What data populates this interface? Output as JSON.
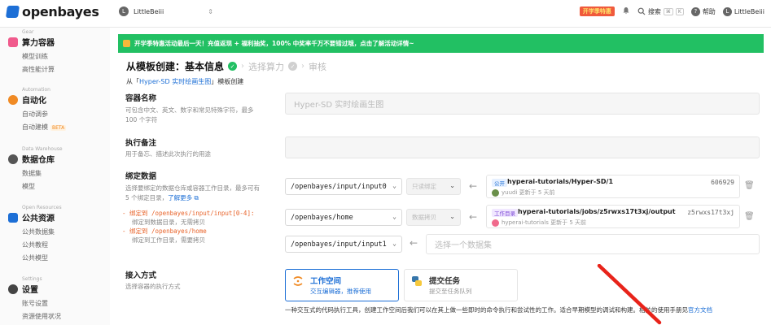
{
  "topbar": {
    "logo": "openbayes",
    "workspace": "LittleBeiii",
    "workspace_avatar": "L",
    "promo_badge": "开学季特惠",
    "search_label": "搜索",
    "search_kbd1": "⌘",
    "search_kbd2": "K",
    "help_label": "帮助",
    "user_name": "LittleBeiii",
    "user_avatar": "L"
  },
  "sidebar": {
    "groups": [
      {
        "category": "Gear",
        "title": "算力容器",
        "items": [
          "模型训练",
          "高性能计算"
        ],
        "icon_color": "#f05a8c"
      },
      {
        "category": "Automation",
        "title": "自动化",
        "items": [
          "自动调参",
          "自动建模"
        ],
        "badge": "BETA",
        "icon_color": "#f08a24"
      },
      {
        "category": "Data Warehouse",
        "title": "数据仓库",
        "items": [
          "数据集",
          "模型"
        ],
        "icon_color": "#555555"
      },
      {
        "category": "Open Resources",
        "title": "公共资源",
        "items": [
          "公共数据集",
          "公共教程",
          "公共模型"
        ],
        "icon_color": "#1d6fd6"
      },
      {
        "category": "Settings",
        "title": "设置",
        "items": [
          "账号设置",
          "资源使用状况"
        ],
        "icon_color": "#444444"
      }
    ]
  },
  "banner": {
    "text": "开学季特惠活动最后一天！充值返现 + 福利抽奖，100% 中奖率千万不要错过哦，点击了解活动详情~"
  },
  "steps": {
    "step1": "从模板创建：基本信息",
    "step2": "选择算力",
    "step3": "审核",
    "from_prefix": "从「",
    "from_link": "Hyper-SD 实时绘画生图",
    "from_suffix": "」模板创建"
  },
  "container_name": {
    "label": "容器名称",
    "help1": "可包含中文、英文、数字和常见特殊字符，最多",
    "help2": "100 个字符",
    "value": "Hyper-SD 实时绘画生图"
  },
  "exec_note": {
    "label": "执行备注",
    "help": "用于备忘、描述此次执行的用途",
    "value": ""
  },
  "bind_data": {
    "label": "绑定数据",
    "help1": "选择要绑定的数据仓库或容器工作目录，最多可有",
    "help2_prefix": "5 个绑定目录，",
    "help2_link": "了解更多",
    "hint1_orange": "- 绑定到 /openbayes/input/input[0-4]:",
    "hint1_grey": "绑定到数据目录，无需拷贝",
    "hint2_orange": "- 绑定到 /openbayes/home",
    "hint2_grey": "绑定到工作目录，需要拷贝",
    "rows": [
      {
        "path": "/openbayes/input/input0",
        "mode": "只读绑定",
        "tag": "公开",
        "title": "hyperai-tutorials/Hyper-SD/1",
        "sub": "yuudi 更新于 5 天前",
        "hash": "606929"
      },
      {
        "path": "/openbayes/home",
        "mode": "数据拷贝",
        "tag": "工作目录",
        "title": "hyperai-tutorials/jobs/z5rwxs17t3xj/output",
        "sub": "hyperai-tutorials 更新于 5 天前",
        "hash": "z5rwxs17t3xj"
      },
      {
        "path": "/openbayes/input/input1",
        "placeholder": "选择一个数据集"
      }
    ]
  },
  "access": {
    "label": "接入方式",
    "help": "选择容器的执行方式",
    "options": [
      {
        "title": "工作空间",
        "sub": "交互编辑器，推荐使用",
        "selected": true
      },
      {
        "title": "提交任务",
        "sub": "提交至任务队列",
        "selected": false
      }
    ],
    "desc": "一种交互式的代码执行工具，创建工作空间后我们可以在其上做一些即时的命令执行和尝试性的工作。适合早期模型的调试和构建。相关的使用手册见",
    "desc_link": "官方文档"
  }
}
